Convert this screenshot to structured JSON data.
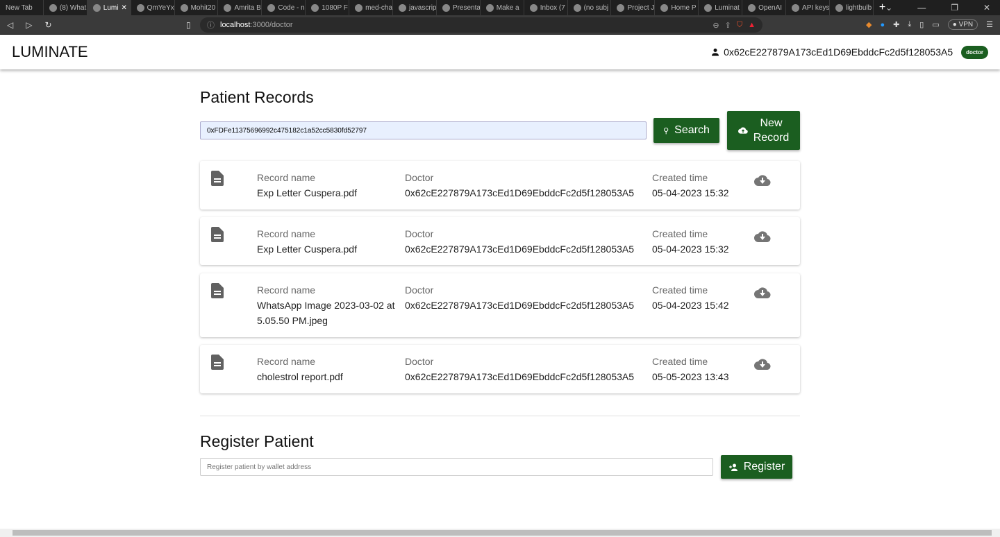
{
  "browser": {
    "tabs": [
      {
        "label": "New Tab"
      },
      {
        "label": "(8) What"
      },
      {
        "label": "Lumi",
        "active": true
      },
      {
        "label": "QmYeYx"
      },
      {
        "label": "Mohit20"
      },
      {
        "label": "Amrita B"
      },
      {
        "label": "Code - n"
      },
      {
        "label": "1080P F"
      },
      {
        "label": "med-cha"
      },
      {
        "label": "javascrip"
      },
      {
        "label": "Presenta"
      },
      {
        "label": "Make a"
      },
      {
        "label": "Inbox (7"
      },
      {
        "label": "(no subj"
      },
      {
        "label": "Project J"
      },
      {
        "label": "Home P"
      },
      {
        "label": "Luminat"
      },
      {
        "label": "OpenAI"
      },
      {
        "label": "API keys"
      },
      {
        "label": "lightbulb"
      }
    ],
    "url_host": "localhost",
    "url_path": ":3000/doctor",
    "vpn_label": "VPN"
  },
  "header": {
    "logo": "LUMINATE",
    "account": "0x62cE227879A173cEd1D69EbddcFc2d5f128053A5",
    "role_badge": "doctor"
  },
  "records_section": {
    "title": "Patient Records",
    "search_value": "0xFDFe11375696992c475182c1a52cc5830fd52797",
    "search_label": "Search",
    "new_record_line1": "New",
    "new_record_line2": "Record",
    "col_name": "Record name",
    "col_doctor": "Doctor",
    "col_time": "Created time",
    "records": [
      {
        "name": "Exp Letter Cuspera.pdf",
        "doctor": "0x62cE227879A173cEd1D69EbddcFc2d5f128053A5",
        "time": "05-04-2023 15:32"
      },
      {
        "name": "Exp Letter Cuspera.pdf",
        "doctor": "0x62cE227879A173cEd1D69EbddcFc2d5f128053A5",
        "time": "05-04-2023 15:32"
      },
      {
        "name": "WhatsApp Image 2023-03-02 at 5.05.50 PM.jpeg",
        "doctor": "0x62cE227879A173cEd1D69EbddcFc2d5f128053A5",
        "time": "05-04-2023 15:42"
      },
      {
        "name": "cholestrol report.pdf",
        "doctor": "0x62cE227879A173cEd1D69EbddcFc2d5f128053A5",
        "time": "05-05-2023 13:43"
      }
    ]
  },
  "register_section": {
    "title": "Register Patient",
    "placeholder": "Register patient by wallet address",
    "button_label": "Register"
  },
  "colors": {
    "accent": "#1b5e20"
  }
}
